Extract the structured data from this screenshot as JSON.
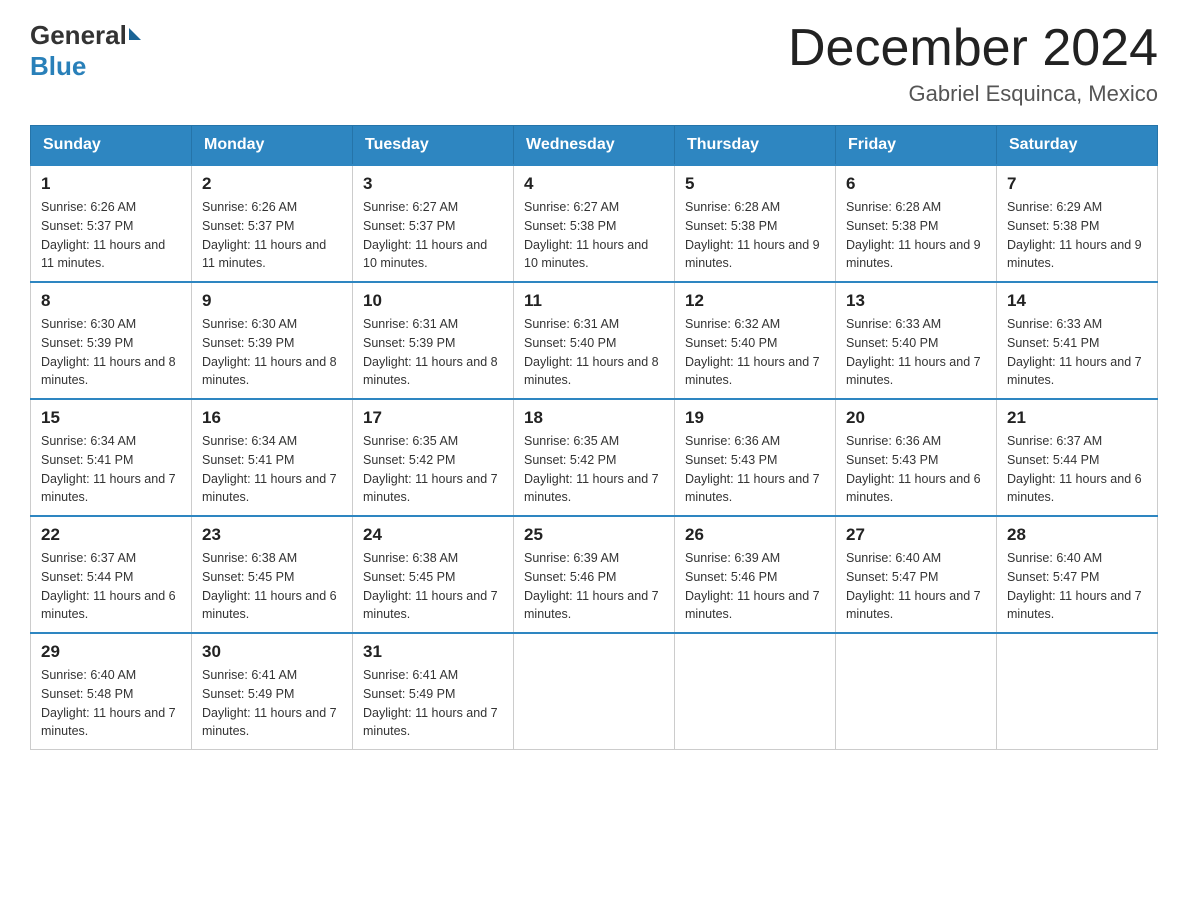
{
  "header": {
    "logo_general": "General",
    "logo_blue": "Blue",
    "month_title": "December 2024",
    "location": "Gabriel Esquinca, Mexico"
  },
  "weekdays": [
    "Sunday",
    "Monday",
    "Tuesday",
    "Wednesday",
    "Thursday",
    "Friday",
    "Saturday"
  ],
  "weeks": [
    [
      {
        "day": "1",
        "sunrise": "6:26 AM",
        "sunset": "5:37 PM",
        "daylight": "11 hours and 11 minutes."
      },
      {
        "day": "2",
        "sunrise": "6:26 AM",
        "sunset": "5:37 PM",
        "daylight": "11 hours and 11 minutes."
      },
      {
        "day": "3",
        "sunrise": "6:27 AM",
        "sunset": "5:37 PM",
        "daylight": "11 hours and 10 minutes."
      },
      {
        "day": "4",
        "sunrise": "6:27 AM",
        "sunset": "5:38 PM",
        "daylight": "11 hours and 10 minutes."
      },
      {
        "day": "5",
        "sunrise": "6:28 AM",
        "sunset": "5:38 PM",
        "daylight": "11 hours and 9 minutes."
      },
      {
        "day": "6",
        "sunrise": "6:28 AM",
        "sunset": "5:38 PM",
        "daylight": "11 hours and 9 minutes."
      },
      {
        "day": "7",
        "sunrise": "6:29 AM",
        "sunset": "5:38 PM",
        "daylight": "11 hours and 9 minutes."
      }
    ],
    [
      {
        "day": "8",
        "sunrise": "6:30 AM",
        "sunset": "5:39 PM",
        "daylight": "11 hours and 8 minutes."
      },
      {
        "day": "9",
        "sunrise": "6:30 AM",
        "sunset": "5:39 PM",
        "daylight": "11 hours and 8 minutes."
      },
      {
        "day": "10",
        "sunrise": "6:31 AM",
        "sunset": "5:39 PM",
        "daylight": "11 hours and 8 minutes."
      },
      {
        "day": "11",
        "sunrise": "6:31 AM",
        "sunset": "5:40 PM",
        "daylight": "11 hours and 8 minutes."
      },
      {
        "day": "12",
        "sunrise": "6:32 AM",
        "sunset": "5:40 PM",
        "daylight": "11 hours and 7 minutes."
      },
      {
        "day": "13",
        "sunrise": "6:33 AM",
        "sunset": "5:40 PM",
        "daylight": "11 hours and 7 minutes."
      },
      {
        "day": "14",
        "sunrise": "6:33 AM",
        "sunset": "5:41 PM",
        "daylight": "11 hours and 7 minutes."
      }
    ],
    [
      {
        "day": "15",
        "sunrise": "6:34 AM",
        "sunset": "5:41 PM",
        "daylight": "11 hours and 7 minutes."
      },
      {
        "day": "16",
        "sunrise": "6:34 AM",
        "sunset": "5:41 PM",
        "daylight": "11 hours and 7 minutes."
      },
      {
        "day": "17",
        "sunrise": "6:35 AM",
        "sunset": "5:42 PM",
        "daylight": "11 hours and 7 minutes."
      },
      {
        "day": "18",
        "sunrise": "6:35 AM",
        "sunset": "5:42 PM",
        "daylight": "11 hours and 7 minutes."
      },
      {
        "day": "19",
        "sunrise": "6:36 AM",
        "sunset": "5:43 PM",
        "daylight": "11 hours and 7 minutes."
      },
      {
        "day": "20",
        "sunrise": "6:36 AM",
        "sunset": "5:43 PM",
        "daylight": "11 hours and 6 minutes."
      },
      {
        "day": "21",
        "sunrise": "6:37 AM",
        "sunset": "5:44 PM",
        "daylight": "11 hours and 6 minutes."
      }
    ],
    [
      {
        "day": "22",
        "sunrise": "6:37 AM",
        "sunset": "5:44 PM",
        "daylight": "11 hours and 6 minutes."
      },
      {
        "day": "23",
        "sunrise": "6:38 AM",
        "sunset": "5:45 PM",
        "daylight": "11 hours and 6 minutes."
      },
      {
        "day": "24",
        "sunrise": "6:38 AM",
        "sunset": "5:45 PM",
        "daylight": "11 hours and 7 minutes."
      },
      {
        "day": "25",
        "sunrise": "6:39 AM",
        "sunset": "5:46 PM",
        "daylight": "11 hours and 7 minutes."
      },
      {
        "day": "26",
        "sunrise": "6:39 AM",
        "sunset": "5:46 PM",
        "daylight": "11 hours and 7 minutes."
      },
      {
        "day": "27",
        "sunrise": "6:40 AM",
        "sunset": "5:47 PM",
        "daylight": "11 hours and 7 minutes."
      },
      {
        "day": "28",
        "sunrise": "6:40 AM",
        "sunset": "5:47 PM",
        "daylight": "11 hours and 7 minutes."
      }
    ],
    [
      {
        "day": "29",
        "sunrise": "6:40 AM",
        "sunset": "5:48 PM",
        "daylight": "11 hours and 7 minutes."
      },
      {
        "day": "30",
        "sunrise": "6:41 AM",
        "sunset": "5:49 PM",
        "daylight": "11 hours and 7 minutes."
      },
      {
        "day": "31",
        "sunrise": "6:41 AM",
        "sunset": "5:49 PM",
        "daylight": "11 hours and 7 minutes."
      },
      null,
      null,
      null,
      null
    ]
  ]
}
